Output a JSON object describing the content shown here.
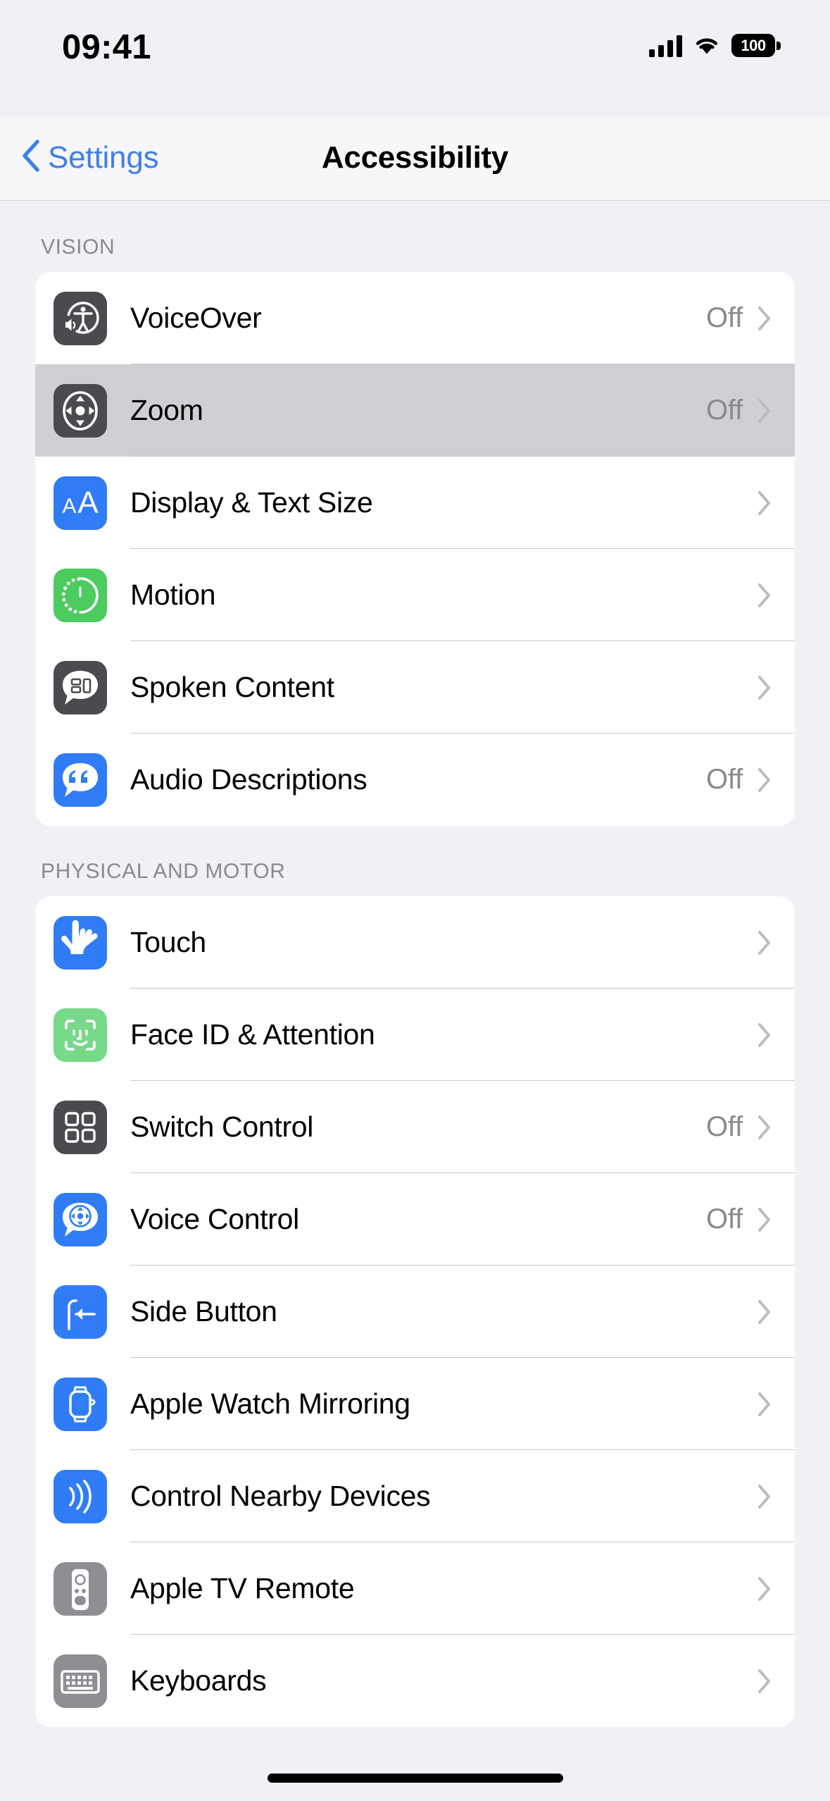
{
  "status_bar": {
    "time": "09:41",
    "battery_percent": "100",
    "icons": [
      "cellular-signal-icon",
      "wifi-icon",
      "battery-icon"
    ]
  },
  "nav_bar": {
    "back_label": "Settings",
    "title": "Accessibility",
    "back_icon": "chevron-left-icon",
    "accent_color": "#3F7FE8"
  },
  "sections": [
    {
      "header": "VISION",
      "rows": [
        {
          "label": "VoiceOver",
          "value": "Off",
          "icon": "voiceover-icon",
          "icon_class": "ic-darkgray",
          "selected": false
        },
        {
          "label": "Zoom",
          "value": "Off",
          "icon": "zoom-icon",
          "icon_class": "ic-darkgray",
          "selected": true
        },
        {
          "label": "Display & Text Size",
          "value": "",
          "icon": "display-text-size-icon",
          "icon_class": "ic-blue",
          "selected": false
        },
        {
          "label": "Motion",
          "value": "",
          "icon": "motion-icon",
          "icon_class": "ic-green",
          "selected": false
        },
        {
          "label": "Spoken Content",
          "value": "",
          "icon": "spoken-content-icon",
          "icon_class": "ic-darkgray",
          "selected": false
        },
        {
          "label": "Audio Descriptions",
          "value": "Off",
          "icon": "audio-descriptions-icon",
          "icon_class": "ic-blue",
          "selected": false
        }
      ]
    },
    {
      "header": "PHYSICAL AND MOTOR",
      "rows": [
        {
          "label": "Touch",
          "value": "",
          "icon": "touch-icon",
          "icon_class": "ic-blue",
          "selected": false
        },
        {
          "label": "Face ID & Attention",
          "value": "",
          "icon": "face-id-icon",
          "icon_class": "ic-lgreen",
          "selected": false
        },
        {
          "label": "Switch Control",
          "value": "Off",
          "icon": "switch-control-icon",
          "icon_class": "ic-darkgray",
          "selected": false
        },
        {
          "label": "Voice Control",
          "value": "Off",
          "icon": "voice-control-icon",
          "icon_class": "ic-blue",
          "selected": false
        },
        {
          "label": "Side Button",
          "value": "",
          "icon": "side-button-icon",
          "icon_class": "ic-blue",
          "selected": false
        },
        {
          "label": "Apple Watch Mirroring",
          "value": "",
          "icon": "apple-watch-mirroring-icon",
          "icon_class": "ic-blue",
          "selected": false
        },
        {
          "label": "Control Nearby Devices",
          "value": "",
          "icon": "control-nearby-devices-icon",
          "icon_class": "ic-blue",
          "selected": false
        },
        {
          "label": "Apple TV Remote",
          "value": "",
          "icon": "apple-tv-remote-icon",
          "icon_class": "ic-gray",
          "selected": false
        },
        {
          "label": "Keyboards",
          "value": "",
          "icon": "keyboards-icon",
          "icon_class": "ic-gray",
          "selected": false
        }
      ]
    }
  ],
  "home_indicator": "home-indicator"
}
